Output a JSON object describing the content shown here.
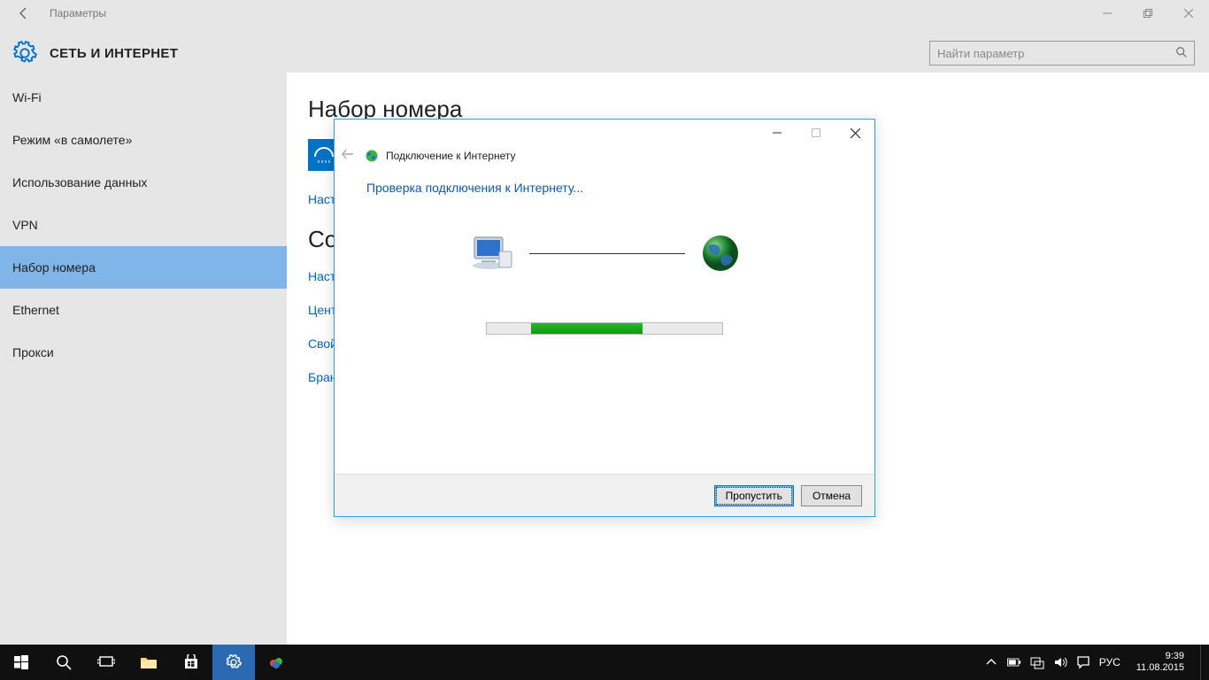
{
  "settings": {
    "window_title": "Параметры",
    "page_title": "СЕТЬ И ИНТЕРНЕТ",
    "search_placeholder": "Найти параметр",
    "sidebar": [
      "Wi-Fi",
      "Режим «в самолете»",
      "Использование данных",
      "VPN",
      "Набор номера",
      "Ethernet",
      "Прокси"
    ],
    "selected_index": 4,
    "section1_title": "Набор номера",
    "setup_link_cut": "Наст",
    "section2_title_cut": "Со",
    "links_cut": [
      "Наст",
      "Цент",
      "Свой",
      "Бран"
    ]
  },
  "dialog": {
    "title": "Подключение к Интернету",
    "message": "Проверка подключения к Интернету...",
    "skip_btn": "Пропустить",
    "cancel_btn": "Отмена"
  },
  "taskbar": {
    "lang": "РУС",
    "time": "9:39",
    "date": "11.08.2015"
  }
}
